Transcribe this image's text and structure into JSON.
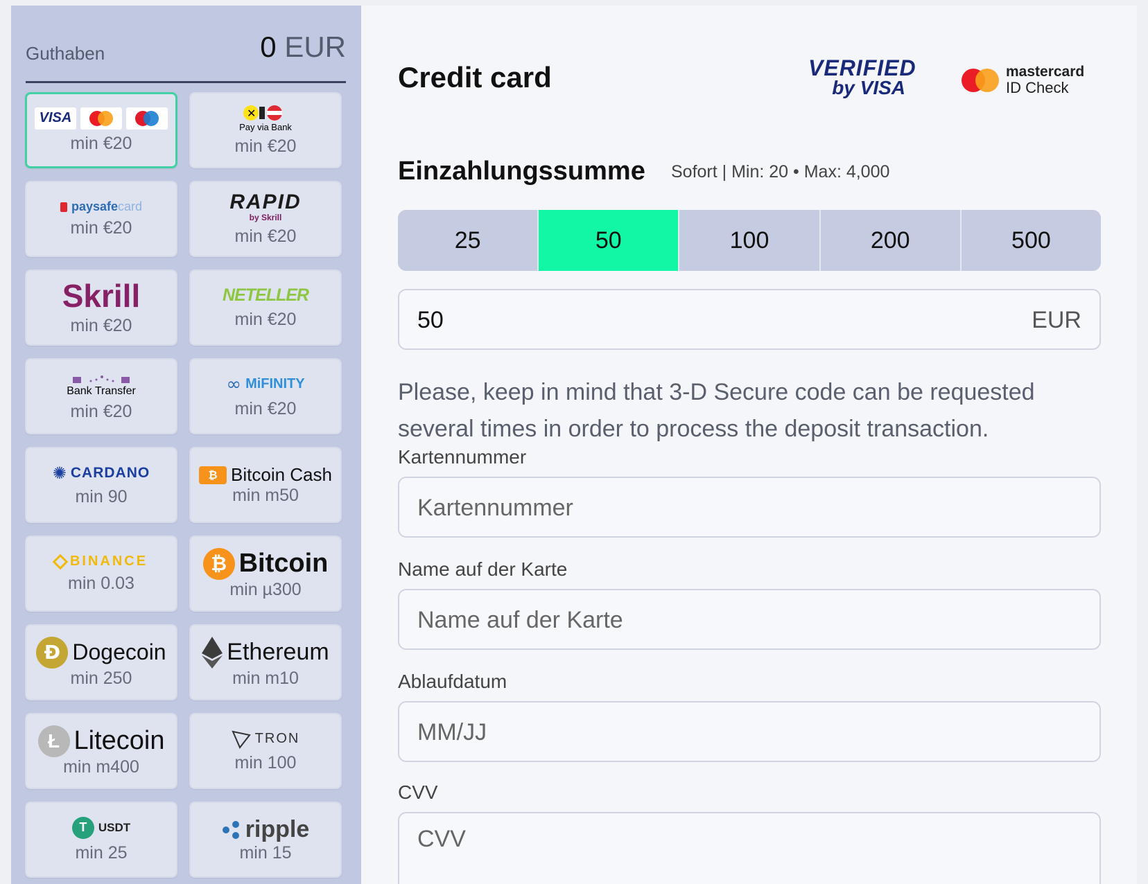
{
  "sidebar": {
    "balance_label": "Guthaben",
    "balance_amount": "0",
    "balance_currency": "EUR",
    "methods": [
      {
        "name": "Visa / Mastercard / Maestro",
        "min": "min €20"
      },
      {
        "name": "Pay via Bank",
        "min": "min €20"
      },
      {
        "name": "paysafecard",
        "min": "min €20"
      },
      {
        "name": "RAPID",
        "sub": "by Skrill",
        "min": "min €20"
      },
      {
        "name": "Skrill",
        "min": "min €20"
      },
      {
        "name": "NETELLER",
        "min": "min €20"
      },
      {
        "name": "Bank Transfer",
        "min": "min €20"
      },
      {
        "name": "MiFINITY",
        "min": "min €20"
      },
      {
        "name": "CARDANO",
        "min": "min 90"
      },
      {
        "name": "Bitcoin Cash",
        "min": "min m50"
      },
      {
        "name": "BINANCE",
        "min": "min 0.03"
      },
      {
        "name": "Bitcoin",
        "min": "min µ300"
      },
      {
        "name": "Dogecoin",
        "min": "min 250"
      },
      {
        "name": "Ethereum",
        "min": "min m10"
      },
      {
        "name": "Litecoin",
        "min": "min m400"
      },
      {
        "name": "TRON",
        "min": "min 100"
      },
      {
        "name": "USDT",
        "min": "min 25"
      },
      {
        "name": "ripple",
        "min": "min 15"
      }
    ],
    "visa_text": "VISA",
    "paysafe_a": "paysafe",
    "paysafe_b": "card"
  },
  "main": {
    "title": "Credit card",
    "vbv_line1": "VERIFIED",
    "vbv_line2": "by VISA",
    "mc_line1": "mastercard",
    "mc_line2": "ID Check",
    "amount_title": "Einzahlungssumme",
    "limits": "Sofort | Min: 20 • Max: 4,000",
    "amounts": [
      "25",
      "50",
      "100",
      "200",
      "500"
    ],
    "amount_value": "50",
    "amount_currency": "EUR",
    "note": "Please, keep in mind that 3-D Secure code can be requested several times in order to process the deposit transaction.",
    "card_number_label": "Kartennummer",
    "card_number_placeholder": "Kartennummer",
    "name_label": "Name auf der Karte",
    "name_placeholder": "Name auf der Karte",
    "expiry_label": "Ablaufdatum",
    "expiry_placeholder": "MM/JJ",
    "cvv_label": "CVV",
    "cvv_placeholder": "CVV"
  },
  "colors": {
    "sidebar_bg": "#c0c8e2",
    "selected_amount": "#12f7a6",
    "active_tile_border": "#43d0a5"
  }
}
